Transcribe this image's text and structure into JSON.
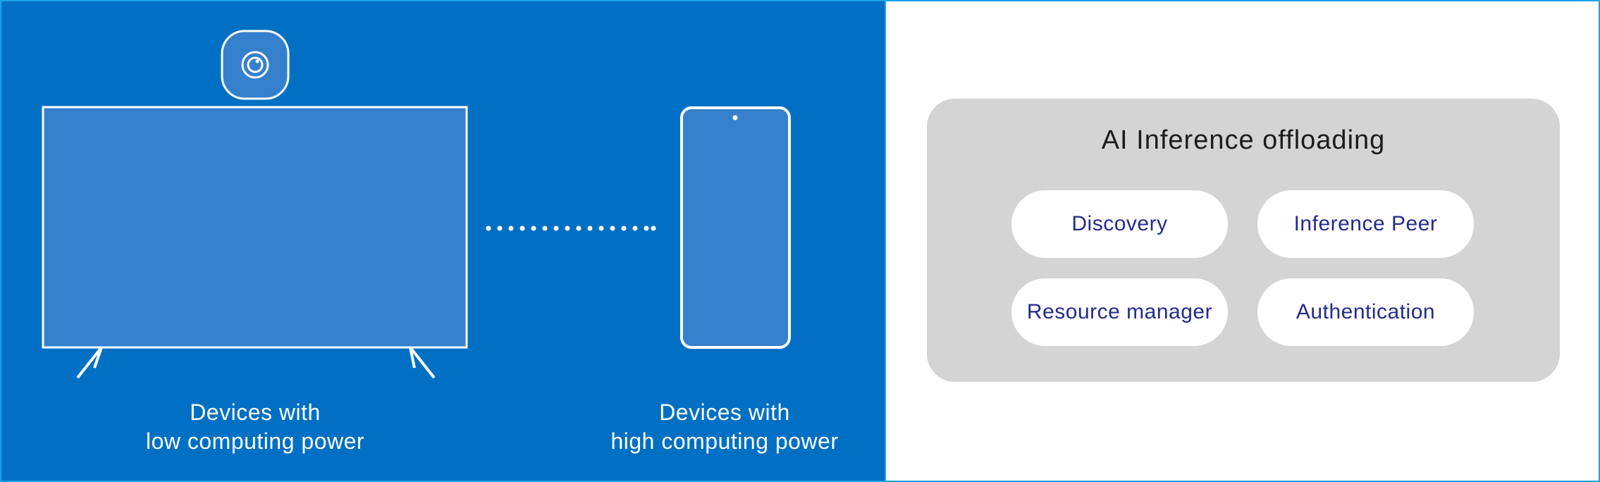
{
  "colors": {
    "left_panel_bg": "#0170c4",
    "device_fill": "#3580cc",
    "device_stroke": "#ffffff",
    "ai_box_bg": "#d4d4d4",
    "pill_text": "#232b8c",
    "frame_border": "#1aa3e8"
  },
  "icons": {
    "tv": "television-icon",
    "camera": "camera-icon",
    "phone": "smartphone-icon",
    "link": "dotted-connection-icon"
  },
  "devices": {
    "low": {
      "line1": "Devices with",
      "line2": "low computing power"
    },
    "high": {
      "line1": "Devices with",
      "line2": "high computing power"
    }
  },
  "ai_offloading": {
    "title": "AI Inference offloading",
    "modules": {
      "discovery": "Discovery",
      "inference_peer": "Inference Peer",
      "resource_manager": "Resource manager",
      "authentication": "Authentication"
    }
  }
}
